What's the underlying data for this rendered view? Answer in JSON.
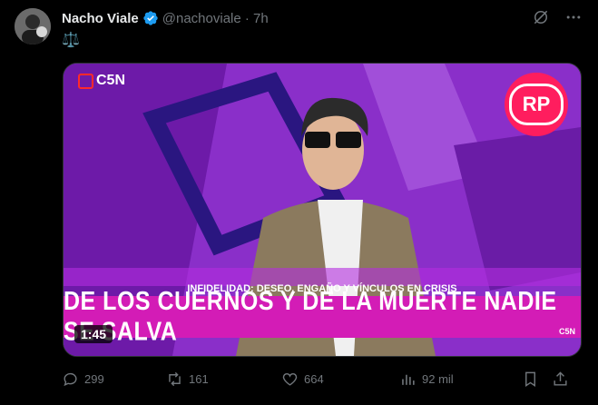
{
  "tweet": {
    "author_name": "Nacho Viale",
    "handle_time": "@nachoviale · 7h",
    "text": "⚖️"
  },
  "media": {
    "channel_logo": "C5N",
    "rp_logo": "RP",
    "ticker_small": "INFIDELIDAD: DESEO, ENGAÑO Y VÍNCULOS EN CRISIS",
    "headline": "DE LOS CUERNOS Y DE LA MUERTE NADIE SE SALVA",
    "corner_logo": "C5N",
    "duration": "1:45"
  },
  "actions": {
    "replies": "299",
    "reposts": "161",
    "likes": "664",
    "views": "92 mil"
  },
  "colors": {
    "background": "#000000",
    "text": "#e7e9ea",
    "muted": "#71767b",
    "verified": "#1d9bf0",
    "lower_third": "#d31cb6",
    "rp_brand": "#ff1d5e"
  },
  "icons": [
    "verified-icon",
    "grok-icon",
    "more-icon",
    "reply-icon",
    "repost-icon",
    "like-icon",
    "views-icon",
    "bookmark-icon",
    "share-icon"
  ]
}
